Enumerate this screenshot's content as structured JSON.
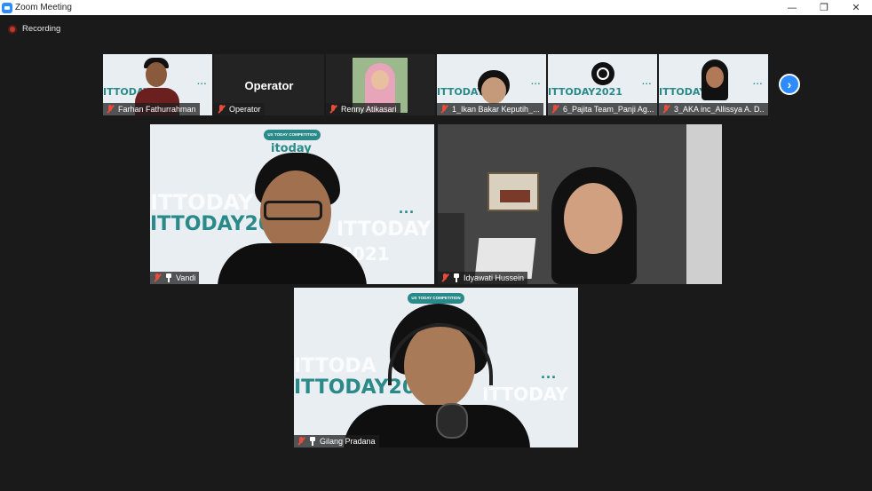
{
  "window": {
    "title": "Zoom Meeting",
    "minimize": "—",
    "maximize": "❐",
    "close": "✕"
  },
  "recording": {
    "label": "Recording"
  },
  "gallery_top": [
    {
      "name": "Farhan Fathurrahman",
      "bg": "ITTODAY20",
      "dots": "..."
    },
    {
      "name": "Operator",
      "display": "Operator"
    },
    {
      "name": "Renny Atikasari"
    },
    {
      "name": "1_Ikan Bakar Keputih_...",
      "bg": "ITTODAY20",
      "dots": "..."
    },
    {
      "name": "6_Pajita Team_Panji Ag...",
      "bg": "ITTODAY2021",
      "dots": "..."
    },
    {
      "name": "3_AKA inc_Allissya A. D...",
      "bg": "ITTODAY20",
      "dots": "..."
    }
  ],
  "speakers": [
    {
      "name": "Vandi",
      "bg": "ITTODAY20",
      "ghost": "ITTODAY",
      "ghost2": "2021",
      "ghost3": "ITTODAY",
      "dots": "...",
      "badge": "UX TODAY COMPETITION",
      "logo": "itoday"
    },
    {
      "name": "Idyawati Hussein"
    },
    {
      "name": "Gilang Pradana",
      "bg": "ITTODAY20",
      "ghost": "ITTODA",
      "ghost2": "ITTODAY",
      "dots": "...",
      "badge": "UX TODAY COMPETITION"
    }
  ],
  "colors": {
    "accent": "#2d8cff",
    "brand_teal": "#2a8a8a",
    "muted_red": "#e74c3c"
  }
}
